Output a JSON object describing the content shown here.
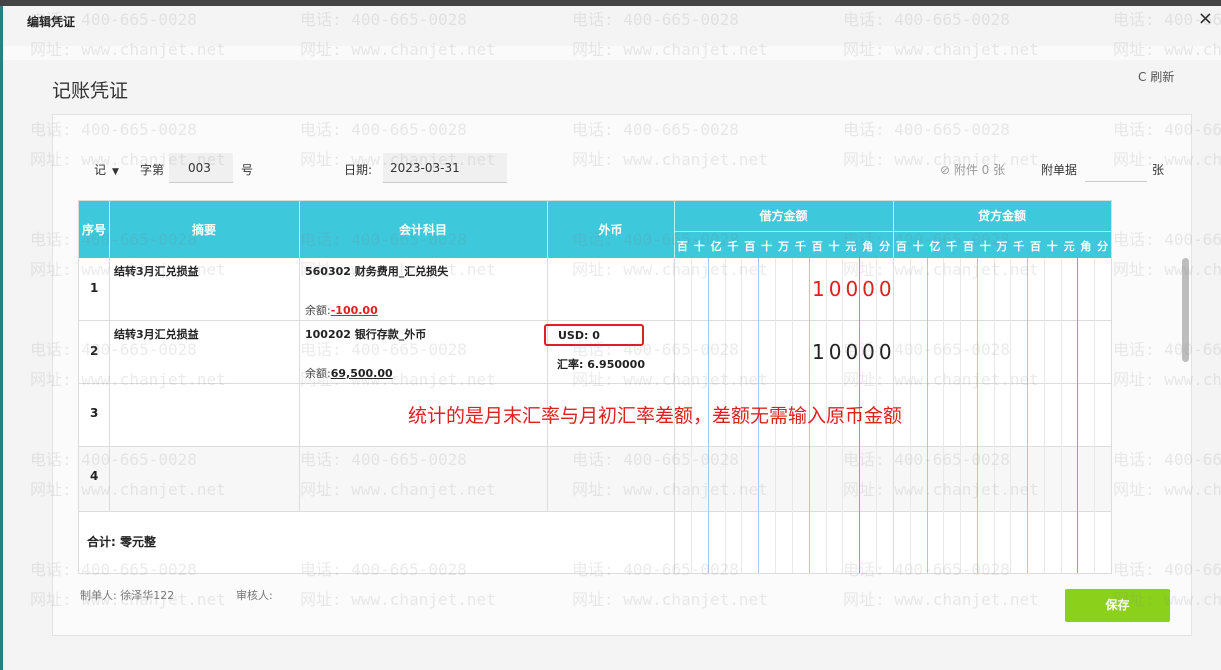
{
  "dialog": {
    "title": "编辑凭证",
    "close": "×"
  },
  "page": {
    "title": "记账凭证",
    "refresh": "C 刷新"
  },
  "voucher": {
    "type": "记",
    "zi_label": "字第",
    "number": "003",
    "hao_label": "号",
    "date_label": "日期:",
    "date": "2023-03-31",
    "attachment_label": "⊘ 附件 0 张",
    "fudan_label": "附单据",
    "fudan_value": "",
    "zhang_label": "张"
  },
  "table": {
    "headers": {
      "seq": "序号",
      "summary": "摘要",
      "account": "会计科目",
      "currency": "外币",
      "debit": "借方金额",
      "credit": "贷方金额"
    },
    "digit_units": [
      "百",
      "十",
      "亿",
      "千",
      "百",
      "十",
      "万",
      "千",
      "百",
      "十",
      "元",
      "角",
      "分"
    ],
    "rows": [
      {
        "seq": "1",
        "summary": "结转3月汇兑损益",
        "account": "560302 财务费用_汇兑损失",
        "balance_label": "余额:",
        "balance": "-100.00",
        "debit": "10000",
        "credit": ""
      },
      {
        "seq": "2",
        "summary": "结转3月汇兑损益",
        "account": "100202 银行存款_外币",
        "balance_label": "余额:",
        "balance": "69,500.00",
        "currency": "USD: 0",
        "rate": "汇率: 6.950000",
        "debit": "",
        "credit": "10000"
      },
      {
        "seq": "3",
        "summary": "",
        "account": ""
      },
      {
        "seq": "4",
        "summary": "",
        "account": ""
      }
    ],
    "total": "合计: 零元整"
  },
  "annotation": "统计的是月末汇率与月初汇率差额，差额无需输入原币金额",
  "footer": {
    "maker": "制单人: 徐泽华122",
    "reviewer": "审核人:",
    "save": "保存"
  },
  "watermark": {
    "phone": "电话: 400-665-0028",
    "site": "网址: www.chanjet.net"
  },
  "colors": {
    "header": "#3dc8dc",
    "save": "#8bd11b",
    "alert": "#e02020"
  }
}
